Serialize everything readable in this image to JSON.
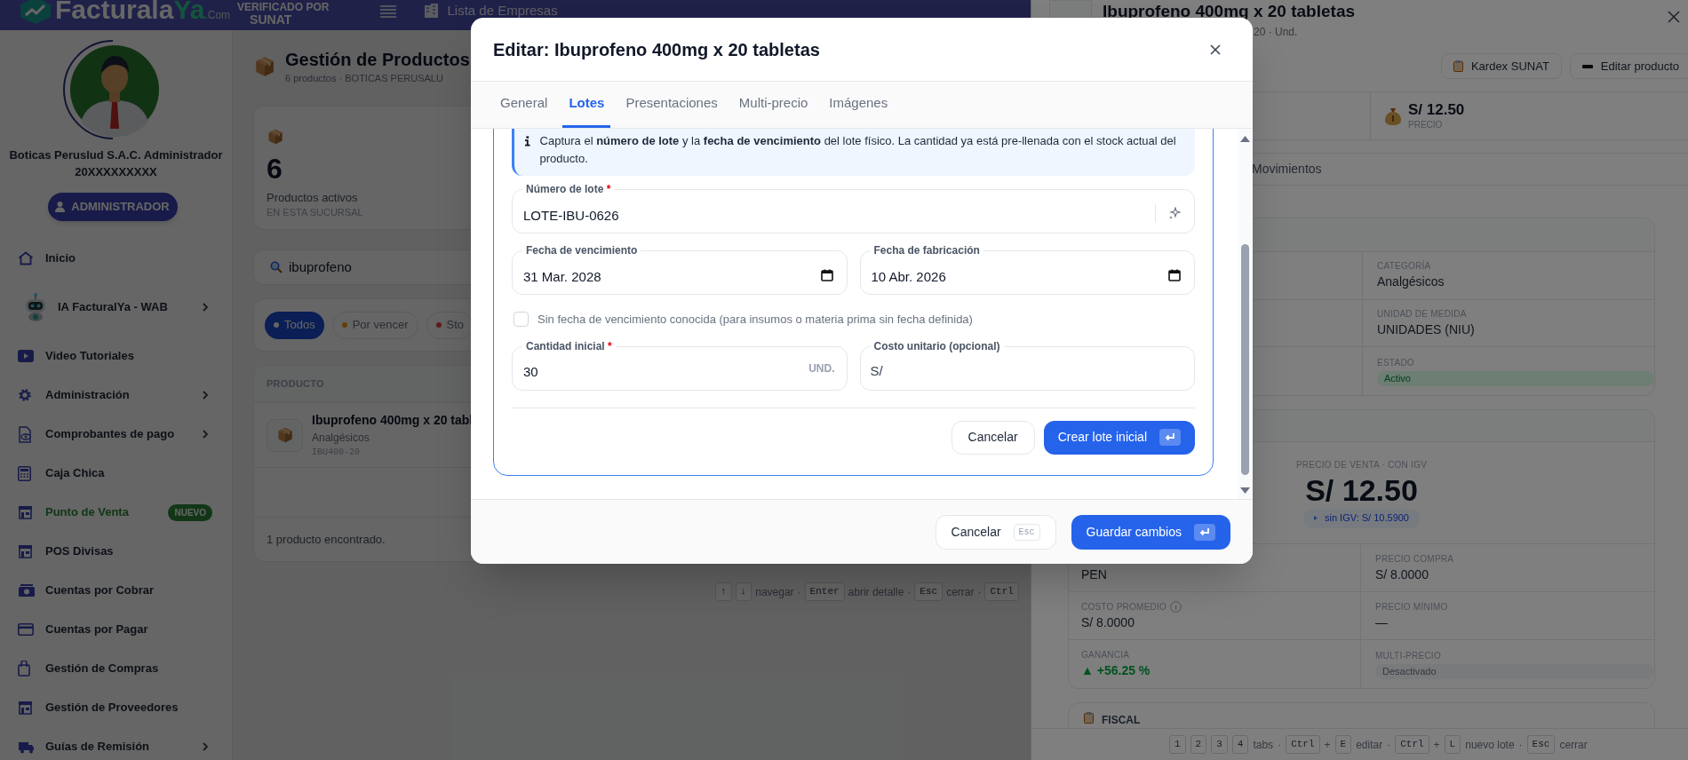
{
  "topbar": {
    "logo": "Facturala",
    "logo_accent": "Ya",
    "logo_suffix": ".Com",
    "verified": "VERIFICADO POR",
    "verified_brand": "SUNAT",
    "companies_link": "Lista de Empresas"
  },
  "sidebar": {
    "company": "Boticas Peruslud S.A.C. Administrador",
    "ruc": "20XXXXXXXXX",
    "role_button": "ADMINISTRADOR",
    "items": [
      {
        "label": "Inicio",
        "expandable": false,
        "highlighted": false
      },
      {
        "label": "IA FacturalYa - WAB",
        "expandable": true,
        "highlighted": false
      },
      {
        "label": "Video Tutoriales",
        "expandable": false,
        "highlighted": false
      },
      {
        "label": "Administración",
        "expandable": true,
        "highlighted": false
      },
      {
        "label": "Comprobantes de pago",
        "expandable": true,
        "highlighted": false
      },
      {
        "label": "Caja Chica",
        "expandable": false,
        "highlighted": false
      },
      {
        "label": "Punto de Venta",
        "expandable": false,
        "highlighted": true,
        "badge": "NUEVO"
      },
      {
        "label": "POS Divisas",
        "expandable": false,
        "highlighted": false
      },
      {
        "label": "Cuentas por Cobrar",
        "expandable": false,
        "highlighted": false
      },
      {
        "label": "Cuentas por Pagar",
        "expandable": false,
        "highlighted": false
      },
      {
        "label": "Gestión de Compras",
        "expandable": false,
        "highlighted": false
      },
      {
        "label": "Gestión de Proveedores",
        "expandable": false,
        "highlighted": false
      },
      {
        "label": "Guías de Remisión",
        "expandable": true,
        "highlighted": false
      }
    ]
  },
  "page": {
    "title": "Gestión de Productos",
    "subtitle": "6 productos · BOTICAS PERUSALU",
    "stat": {
      "value": "6",
      "label": "Productos activos",
      "sublabel": "EN ESTA SUCURSAL"
    },
    "search": {
      "value": "ibuprofeno"
    },
    "filters": [
      {
        "label": "Todos",
        "selected": true,
        "color": "#666666"
      },
      {
        "label": "Por vencer",
        "selected": false,
        "color": "#623f04"
      },
      {
        "label": "Sto",
        "selected": false,
        "color": "#601b1b"
      }
    ],
    "table": {
      "columns": [
        "PRODUCTO"
      ],
      "rows": [
        {
          "name": "Ibuprofeno 400mg x 20 tabl",
          "category": "Analgésicos",
          "code": "IBU400-20"
        }
      ],
      "footer": "1 producto encontrado."
    },
    "shortcuts": [
      {
        "kind": "key",
        "text": "↑"
      },
      {
        "kind": "key",
        "text": "↓"
      },
      {
        "kind": "text",
        "text": "navegar"
      },
      {
        "kind": "text",
        "text": "·"
      },
      {
        "kind": "key",
        "text": "Enter"
      },
      {
        "kind": "text",
        "text": "abrir detalle"
      },
      {
        "kind": "text",
        "text": "·"
      },
      {
        "kind": "key",
        "text": "Esc"
      },
      {
        "kind": "text",
        "text": "cerrar"
      },
      {
        "kind": "text",
        "text": "·"
      },
      {
        "kind": "key",
        "text": "Ctrl"
      }
    ]
  },
  "drawer": {
    "title": "Ibuprofeno 400mg x 20 tabletas",
    "subtitle": "20 · Und.",
    "actions": [
      "Kardex SUNAT",
      "Editar producto"
    ],
    "price_stat": {
      "value": "S/ 12.50",
      "label": "PRECIO"
    },
    "tabs": [
      {
        "label": "Movimientos",
        "selected": false
      }
    ],
    "general_fields": [
      {
        "label": "CATEGORÍA",
        "value": "Analgésicos",
        "kind": "text"
      },
      {
        "label": "UNIDAD DE MEDIDA",
        "value": "UNIDADES (NIU)",
        "kind": "text"
      },
      {
        "label": "ESTADO",
        "value": "Activo",
        "kind": "status"
      }
    ],
    "price": {
      "label": "PRECIO DE VENTA · CON IGV",
      "value": "S/ 12.50",
      "net": "sin IGV: S/ 10.5900"
    },
    "price_rows": [
      {
        "cells": [
          {
            "value": "PEN",
            "kind": "text"
          },
          {
            "label": "PRECIO COMPRA",
            "value": "S/ 8.0000",
            "kind": "text"
          }
        ]
      },
      {
        "cells": [
          {
            "label": "COSTO PROMEDIO",
            "value": "S/ 8.0000",
            "kind": "info"
          },
          {
            "label": "PRECIO MÍNIMO",
            "value": "—",
            "kind": "text"
          }
        ]
      },
      {
        "cells": [
          {
            "label": "GANANCIA",
            "value": "▲ +56.25 %",
            "kind": "gain"
          },
          {
            "label": "MULTI-PRECIO",
            "value": "Desactivado",
            "kind": "pill"
          }
        ]
      }
    ],
    "sections": [
      {
        "title": "FISCAL"
      }
    ],
    "shortcuts": [
      {
        "kind": "key",
        "text": "1"
      },
      {
        "kind": "key",
        "text": "2"
      },
      {
        "kind": "key",
        "text": "3"
      },
      {
        "kind": "key",
        "text": "4"
      },
      {
        "kind": "text",
        "text": "tabs"
      },
      {
        "kind": "text",
        "text": "·"
      },
      {
        "kind": "key",
        "text": "Ctrl"
      },
      {
        "kind": "text",
        "text": "+"
      },
      {
        "kind": "key",
        "text": "E"
      },
      {
        "kind": "text",
        "text": "editar"
      },
      {
        "kind": "text",
        "text": "·"
      },
      {
        "kind": "key",
        "text": "Ctrl"
      },
      {
        "kind": "text",
        "text": "+"
      },
      {
        "kind": "key",
        "text": "L"
      },
      {
        "kind": "text",
        "text": "nuevo lote"
      },
      {
        "kind": "text",
        "text": "·"
      },
      {
        "kind": "key",
        "text": "Esc"
      },
      {
        "kind": "text",
        "text": "cerrar"
      }
    ]
  },
  "modal": {
    "title": "Editar: Ibuprofeno 400mg x 20 tabletas",
    "tabs": [
      {
        "label": "General",
        "selected": false
      },
      {
        "label": "Lotes",
        "selected": true
      },
      {
        "label": "Presentaciones",
        "selected": false
      },
      {
        "label": "Multi-precio",
        "selected": false
      },
      {
        "label": "Imágenes",
        "selected": false
      }
    ],
    "info": "Captura el **número de lote** y la **fecha de vencimiento** del lote físico. La cantidad ya está pre-llenada con el stock actual del producto.",
    "lot_number": {
      "label": "Número de lote",
      "required_mark": "*",
      "value": "LOTE-IBU-0626"
    },
    "expiry": {
      "label": "Fecha de vencimiento",
      "value": "31 Mar. 2028"
    },
    "manufactured": {
      "label": "Fecha de fabricación",
      "value": "10 Abr. 2026"
    },
    "no_expiry": {
      "label": "Sin fecha de vencimiento conocida (para insumos o materia prima sin fecha definida)",
      "checked": false
    },
    "quantity": {
      "label": "Cantidad inicial",
      "required_mark": "*",
      "value": "30",
      "unit": "UND."
    },
    "unit_cost": {
      "label": "Costo unitario (opcional)",
      "prefix": "S/"
    },
    "form_buttons": [
      "Cancelar",
      "Crear lote inicial"
    ],
    "footer_buttons": [
      {
        "label": "Cancelar",
        "shortcut": "Esc"
      },
      {
        "label": "Guardar cambios"
      }
    ]
  }
}
